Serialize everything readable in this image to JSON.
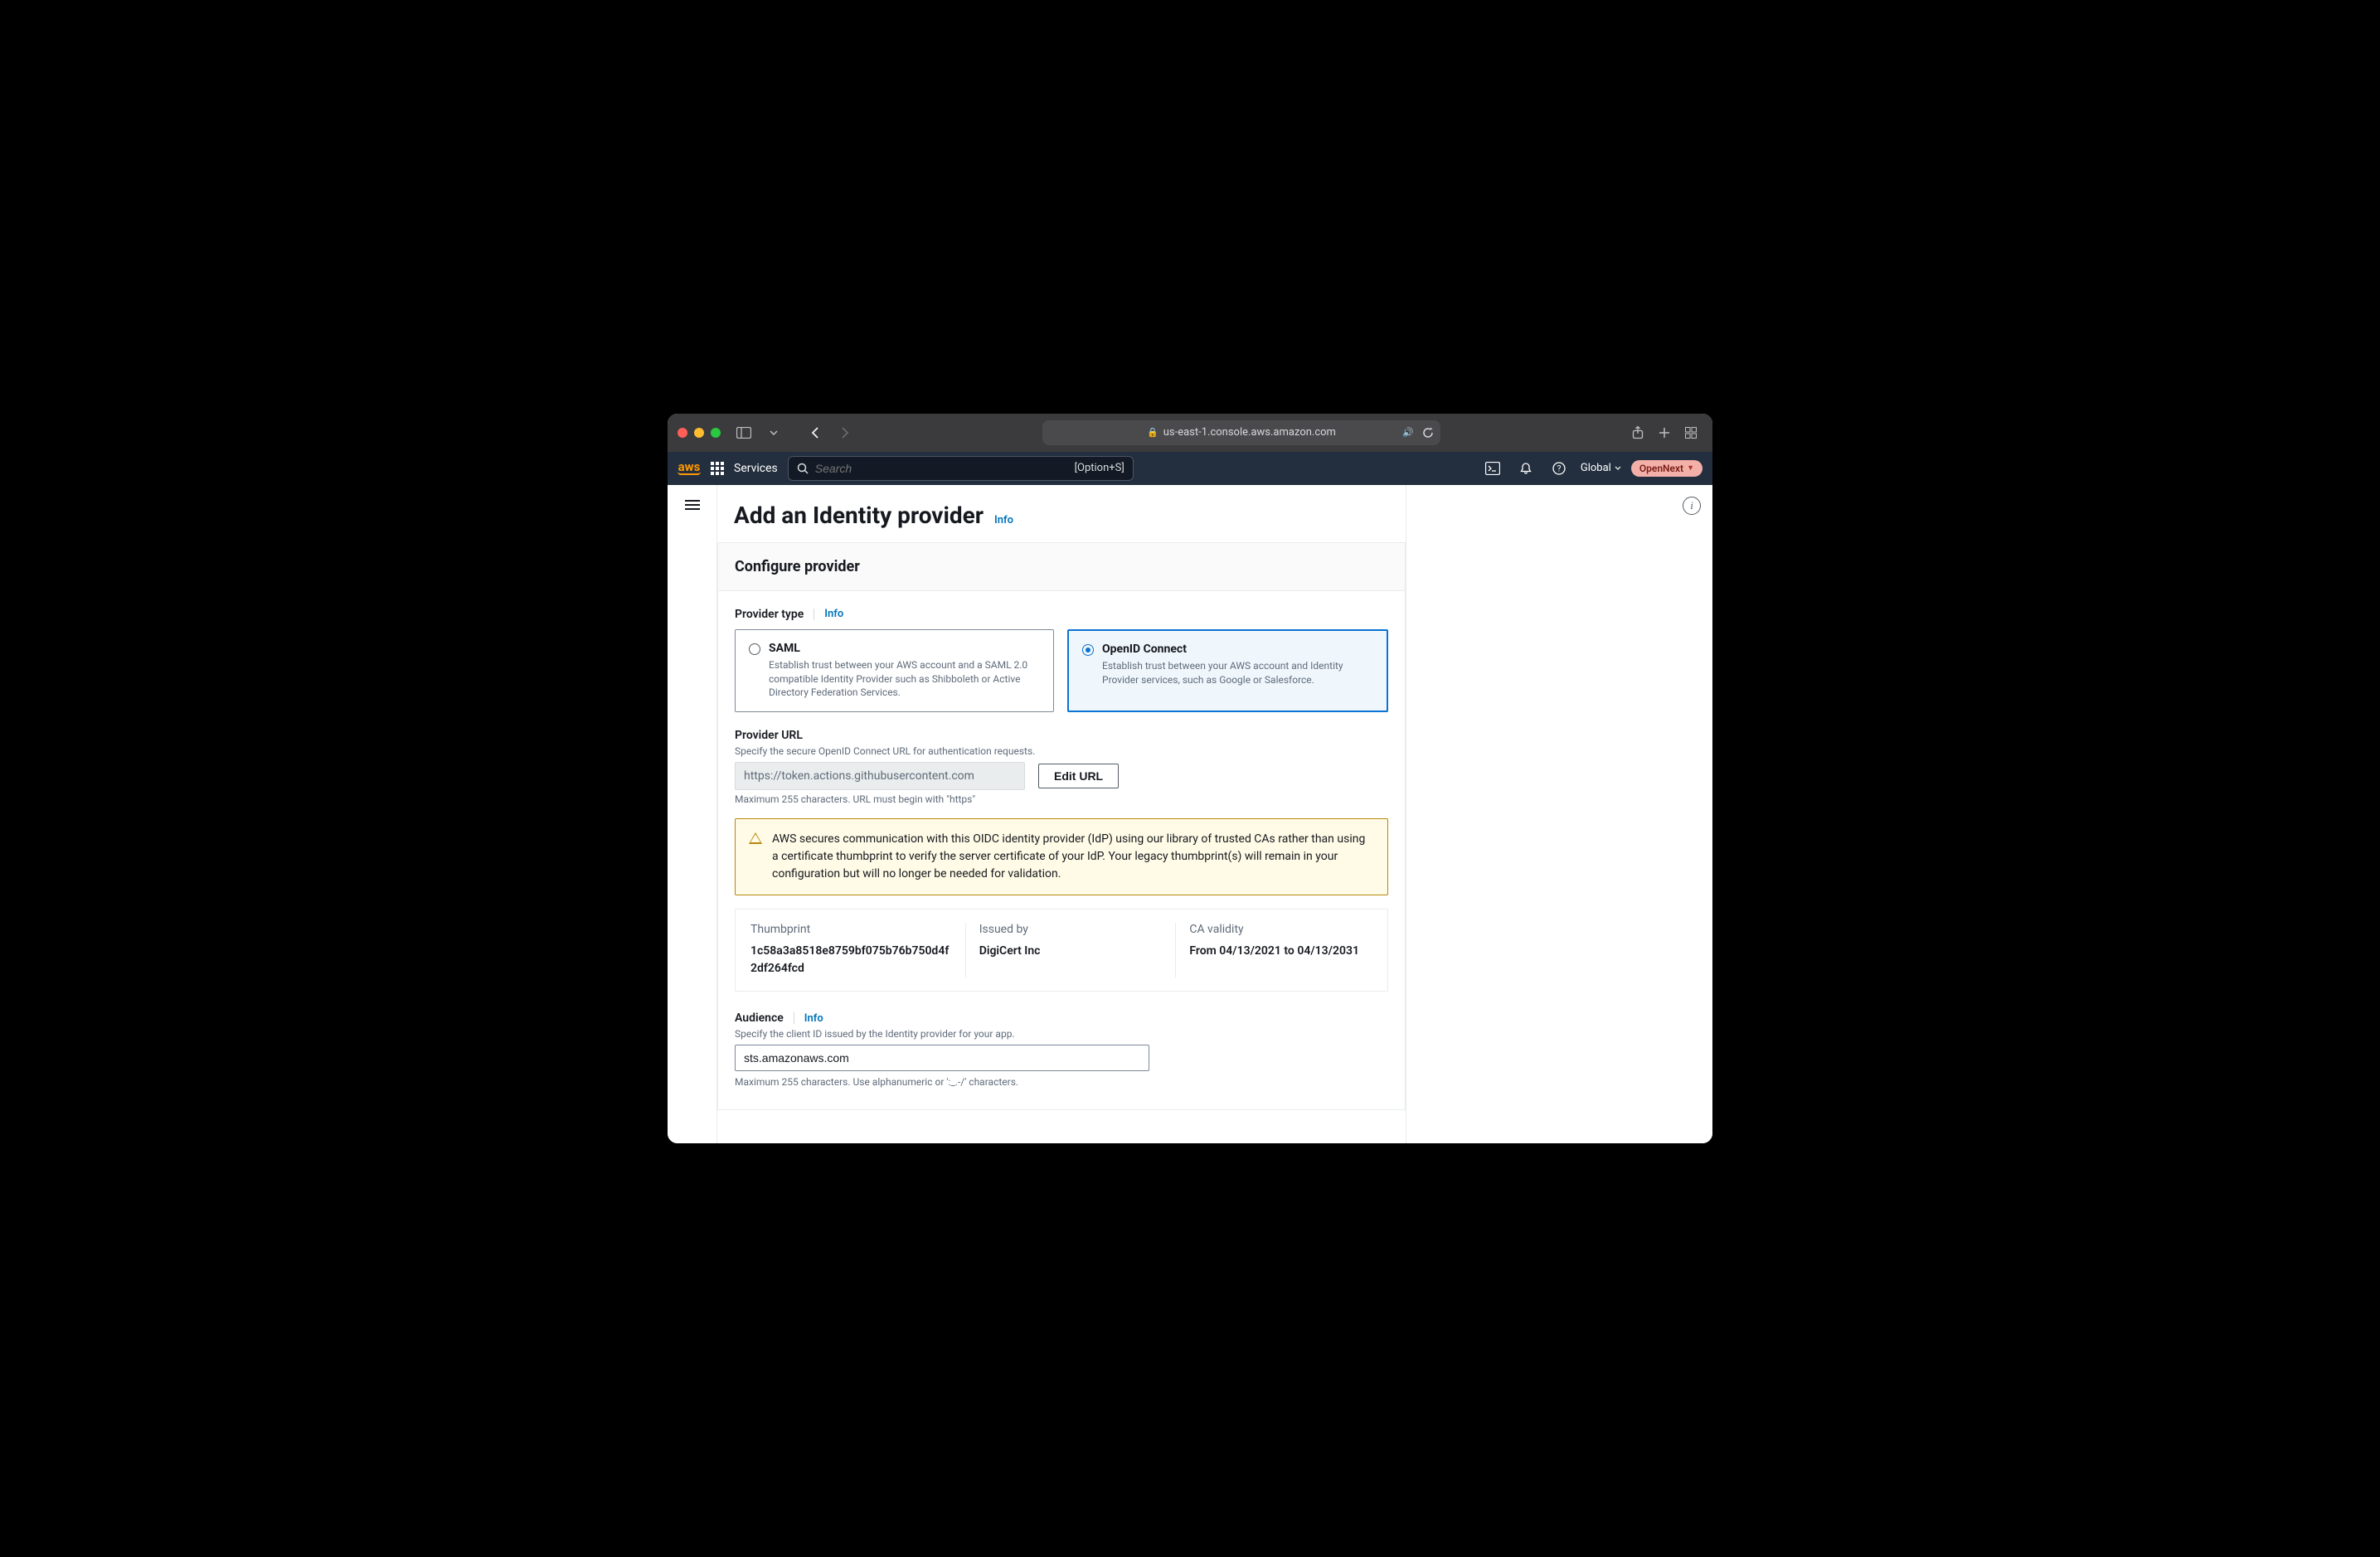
{
  "browser": {
    "url_display": "us-east-1.console.aws.amazon.com"
  },
  "aws_nav": {
    "services": "Services",
    "search_placeholder": "Search",
    "search_hint": "[Option+S]",
    "region": "Global",
    "account": "OpenNext"
  },
  "page": {
    "title": "Add an Identity provider",
    "info": "Info"
  },
  "panel": {
    "title": "Configure provider"
  },
  "provider_type": {
    "label": "Provider type",
    "info": "Info",
    "options": [
      {
        "title": "SAML",
        "desc": "Establish trust between your AWS account and a SAML 2.0 compatible Identity Provider such as Shibboleth or Active Directory Federation Services.",
        "selected": false
      },
      {
        "title": "OpenID Connect",
        "desc": "Establish trust between your AWS account and Identity Provider services, such as Google or Salesforce.",
        "selected": true
      }
    ]
  },
  "provider_url": {
    "label": "Provider URL",
    "hint": "Specify the secure OpenID Connect URL for authentication requests.",
    "value": "https://token.actions.githubusercontent.com",
    "edit_button": "Edit URL",
    "constraint": "Maximum 255 characters. URL must begin with \"https\""
  },
  "alert_text": "AWS secures communication with this OIDC identity provider (IdP) using our library of trusted CAs rather than using a certificate thumbprint to verify the server certificate of your IdP. Your legacy thumbprint(s) will remain in your configuration but will no longer be needed for validation.",
  "cert": {
    "thumbprint_label": "Thumbprint",
    "thumbprint": "1c58a3a8518e8759bf075b76b750d4f2df264fcd",
    "issued_by_label": "Issued by",
    "issued_by": "DigiCert Inc",
    "validity_label": "CA validity",
    "validity": "From 04/13/2021 to 04/13/2031"
  },
  "audience": {
    "label": "Audience",
    "info": "Info",
    "hint": "Specify the client ID issued by the Identity provider for your app.",
    "value": "sts.amazonaws.com",
    "constraint": "Maximum 255 characters. Use alphanumeric or ':_.-/' characters."
  }
}
